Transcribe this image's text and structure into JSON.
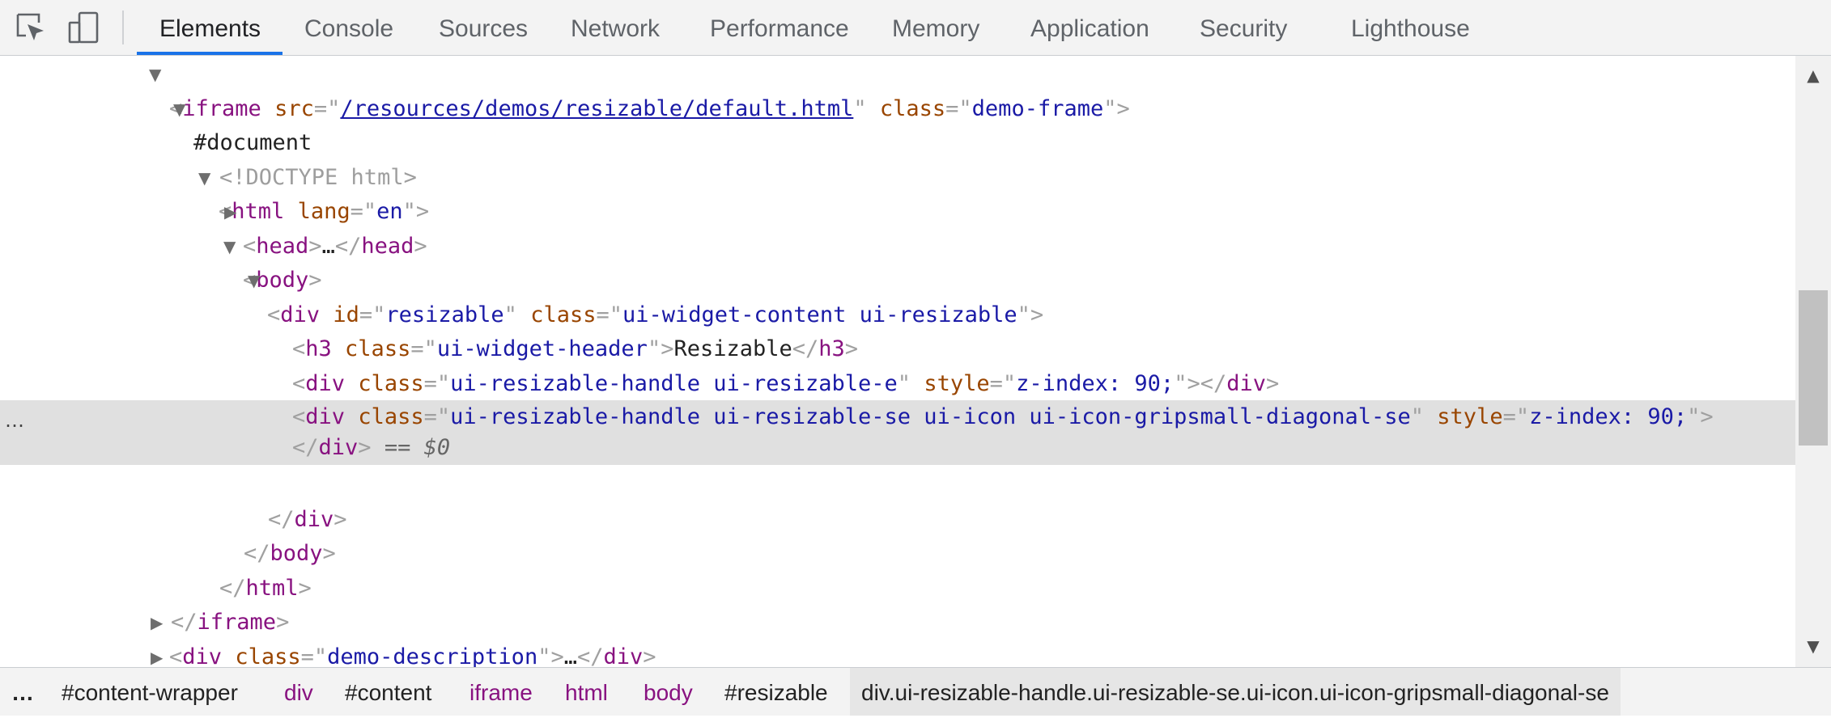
{
  "toolbar": {
    "inspect_icon": "inspect-element-icon",
    "device_icon": "device-toolbar-icon",
    "tabs": [
      {
        "label": "Elements",
        "active": true
      },
      {
        "label": "Console"
      },
      {
        "label": "Sources"
      },
      {
        "label": "Network"
      },
      {
        "label": "Performance"
      },
      {
        "label": "Memory"
      },
      {
        "label": "Application"
      },
      {
        "label": "Security"
      },
      {
        "label": "Lighthouse"
      }
    ],
    "accent_color": "#1a73e8"
  },
  "tree": {
    "iframe_tag": "iframe",
    "iframe_src_attr": "src",
    "iframe_src": "/resources/demos/resizable/default.html",
    "iframe_class_attr": "class",
    "iframe_class": "demo-frame",
    "document": "#document",
    "doctype": "<!DOCTYPE html>",
    "html_tag": "html",
    "html_lang_attr": "lang",
    "html_lang": "en",
    "head_tag": "head",
    "collapsed": "…",
    "body_tag": "body",
    "div_tag": "div",
    "resizable_id_attr": "id",
    "resizable_id": "resizable",
    "class_attr": "class",
    "resizable_class": "ui-widget-content ui-resizable",
    "h3_tag": "h3",
    "h3_class": "ui-widget-header",
    "h3_text": "Resizable",
    "style_attr": "style",
    "handle_e_class": "ui-resizable-handle ui-resizable-e",
    "handle_s_class": "ui-resizable-handle ui-resizable-s",
    "handle_se_class": "ui-resizable-handle ui-resizable-se ui-icon ui-icon-gripsmall-diagonal-se",
    "z_style": "z-index: 90;",
    "selected_marker": "== $0",
    "description_class": "demo-description",
    "view_source_class": "view-source",
    "row_actions": "…"
  },
  "breadcrumbs": {
    "more": "…",
    "items": [
      {
        "label": "#content-wrapper",
        "kind": "id"
      },
      {
        "label": "div",
        "kind": "tag"
      },
      {
        "label": "#content",
        "kind": "id"
      },
      {
        "label": "iframe",
        "kind": "tag"
      },
      {
        "label": "html",
        "kind": "tag"
      },
      {
        "label": "body",
        "kind": "tag"
      },
      {
        "label": "#resizable",
        "kind": "id"
      },
      {
        "label": "div.ui-resizable-handle.ui-resizable-se.ui-icon.ui-icon-gripsmall-diagonal-se",
        "kind": "active"
      }
    ]
  }
}
